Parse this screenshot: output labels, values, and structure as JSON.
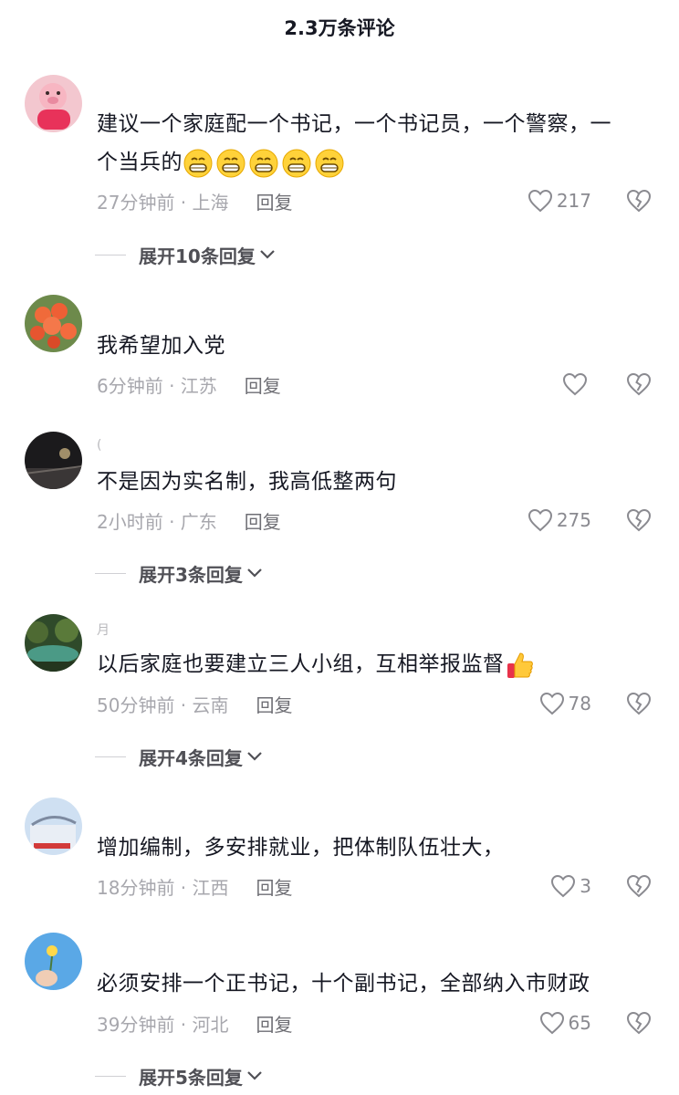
{
  "header": {
    "title": "2.3万条评论"
  },
  "comments": [
    {
      "username": "",
      "text": "建议一个家庭配一个书记，一个书记员，一个警察，一个当兵的",
      "text_line1": "建议一个家庭配一个书记，一个书记员，一个警察，一",
      "text_line2": "个当兵的",
      "emojis": [
        "grin-emoji",
        "grin-emoji",
        "grin-emoji",
        "grin-emoji",
        "grin-emoji"
      ],
      "time_location": "27分钟前 · 上海",
      "reply_label": "回复",
      "likes": "217",
      "expand_label": "展开10条回复"
    },
    {
      "username": "",
      "text": "我希望加入党",
      "time_location": "6分钟前 · 江苏",
      "reply_label": "回复",
      "likes": ""
    },
    {
      "username": "(",
      "text": "不是因为实名制，我高低整两句",
      "time_location": "2小时前 · 广东",
      "reply_label": "回复",
      "likes": "275",
      "expand_label": "展开3条回复"
    },
    {
      "username": "月",
      "text": "以后家庭也要建立三人小组，互相举报监督",
      "emojis": [
        "thumbs-up-emoji"
      ],
      "time_location": "50分钟前 · 云南",
      "reply_label": "回复",
      "likes": "78",
      "expand_label": "展开4条回复"
    },
    {
      "username": "",
      "text": "增加编制，多安排就业，把体制队伍壮大，",
      "time_location": "18分钟前 · 江西",
      "reply_label": "回复",
      "likes": "3"
    },
    {
      "username": "",
      "text": "必须安排一个正书记，十个副书记，全部纳入市财政",
      "time_location": "39分钟前 · 河北",
      "reply_label": "回复",
      "likes": "65",
      "expand_label": "展开5条回复"
    }
  ],
  "icons": {
    "like": "heart-outline-icon",
    "dislike": "broken-heart-icon",
    "expand": "chevron-down-icon"
  },
  "colors": {
    "text_primary": "#161823",
    "text_secondary": "#a7a7ad",
    "reply": "#6e6e74",
    "icon": "#8a8a90"
  }
}
